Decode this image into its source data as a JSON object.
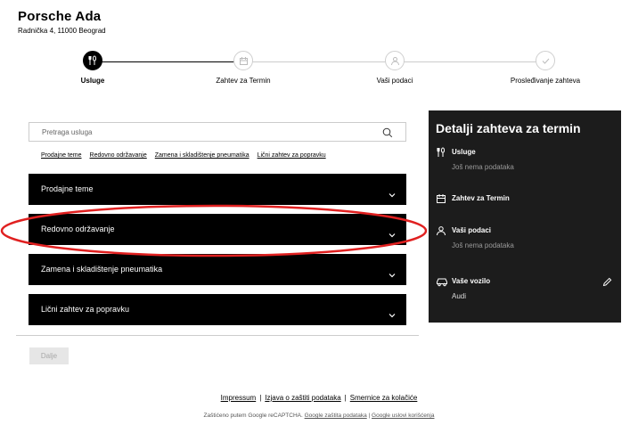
{
  "dealer": {
    "name": "Porsche Ada",
    "address": "Radnička 4, 11000 Beograd"
  },
  "steps": [
    {
      "label": "Usluge",
      "icon": "wrench-tools-icon",
      "active": true
    },
    {
      "label": "Zahtev za Termin",
      "icon": "calendar-icon",
      "active": false
    },
    {
      "label": "Vaši podaci",
      "icon": "user-icon",
      "active": false
    },
    {
      "label": "Prosleđivanje zahteva",
      "icon": "checkmark-icon",
      "active": false
    }
  ],
  "search": {
    "placeholder": "Pretraga usluga"
  },
  "quick_links": [
    "Prodajne teme",
    "Redovno održavanje",
    "Zamena i skladištenje pneumatika",
    "Lični zahtev za popravku"
  ],
  "categories": [
    "Prodajne teme",
    "Redovno održavanje",
    "Zamena i skladištenje pneumatika",
    "Lični zahtev za popravku"
  ],
  "next_button": "Dalje",
  "summary": {
    "title": "Detalji zahteva za termin",
    "services": {
      "heading": "Usluge",
      "value": "Još nema podataka"
    },
    "appointment": {
      "heading": "Zahtev za Termin"
    },
    "personal": {
      "heading": "Vaši podaci",
      "value": "Još nema podataka"
    },
    "vehicle": {
      "heading": "Vaše vozilo",
      "value": "Audi"
    }
  },
  "footer": {
    "links": [
      "Impressum",
      "Izjava o zaštiti podataka",
      "Smernice za kolačiće"
    ],
    "recaptcha_text": "Zaštićeno putem Google reCAPTCHA.",
    "recaptcha_links": [
      "Google zaštita podataka",
      "Google uslovi korišćenja"
    ]
  },
  "colors": {
    "accent": "#000000",
    "panel_bg": "#1c1c1c",
    "annotation": "#e02020"
  }
}
